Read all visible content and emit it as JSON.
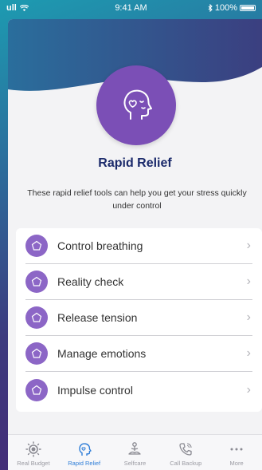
{
  "status": {
    "signal": "ull",
    "time": "9:41 AM",
    "battery": "100%"
  },
  "header": {
    "title": "Rapid Relief",
    "subtitle": "These rapid relief tools can help you get your stress quickly under control"
  },
  "tools": [
    {
      "label": "Control breathing"
    },
    {
      "label": "Reality check"
    },
    {
      "label": "Release tension"
    },
    {
      "label": "Manage emotions"
    },
    {
      "label": "Impulse control"
    }
  ],
  "tabbar": [
    {
      "label": "Real Budget",
      "icon": "sun-icon",
      "active": false
    },
    {
      "label": "Rapid Relief",
      "icon": "head-icon",
      "active": true
    },
    {
      "label": "Selfcare",
      "icon": "meditation-icon",
      "active": false
    },
    {
      "label": "Call Backup",
      "icon": "phone-icon",
      "active": false
    },
    {
      "label": "More",
      "icon": "more-icon",
      "active": false
    }
  ],
  "colors": {
    "accent": "#7b4fb6",
    "title": "#1b2a6b",
    "active_tab": "#2f7ed8"
  }
}
